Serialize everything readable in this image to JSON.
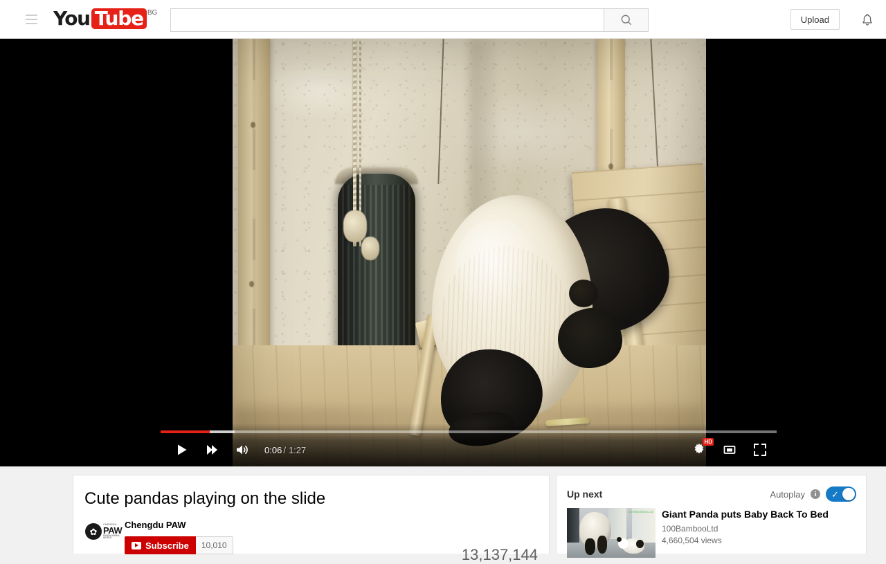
{
  "header": {
    "menu_icon": "hamburger-menu-icon",
    "logo_you": "You",
    "logo_tube": "Tube",
    "logo_country": "BG",
    "search": {
      "value": "",
      "placeholder": "",
      "icon": "search-icon"
    },
    "upload_label": "Upload",
    "bell_icon": "notifications-bell-icon"
  },
  "player": {
    "state": "paused",
    "play_icon": "play-icon",
    "next_icon": "next-track-icon",
    "volume_icon": "volume-on-icon",
    "current_time": "0:06",
    "time_separator": "/",
    "duration": "1:27",
    "progress_percent": 8,
    "loaded_percent": 12,
    "settings_icon": "settings-gear-icon",
    "quality_badge": "HD",
    "miniplayer_icon": "miniplayer-icon",
    "fullscreen_icon": "fullscreen-icon",
    "accent_color": "#e62117",
    "scene_description": "Giant panda climbing down a wooden ramp inside a concrete enclosure"
  },
  "video": {
    "title": "Cute pandas playing on the slide",
    "channel": "Chengdu PAW",
    "avatar": {
      "paw_glyph": "✿",
      "top_text": "CHENGDU",
      "main_text": "PAW",
      "bottom_text": "PANDA ANIMAL WORLD"
    },
    "subscribe_label": "Subscribe",
    "subscriber_count": "10,010",
    "subscribe_color": "#cc0000",
    "view_count": "13,137,144"
  },
  "sidebar": {
    "up_next_label": "Up next",
    "autoplay_label": "Autoplay",
    "info_icon": "info-icon",
    "autoplay_on": true,
    "toggle_color": "#167ac6",
    "items": [
      {
        "title": "Giant Panda puts Baby Back To Bed",
        "channel": "100BambooLtd",
        "views": "4,660,504 views",
        "thumbnail_watermark": "100BambooLtd"
      }
    ]
  }
}
